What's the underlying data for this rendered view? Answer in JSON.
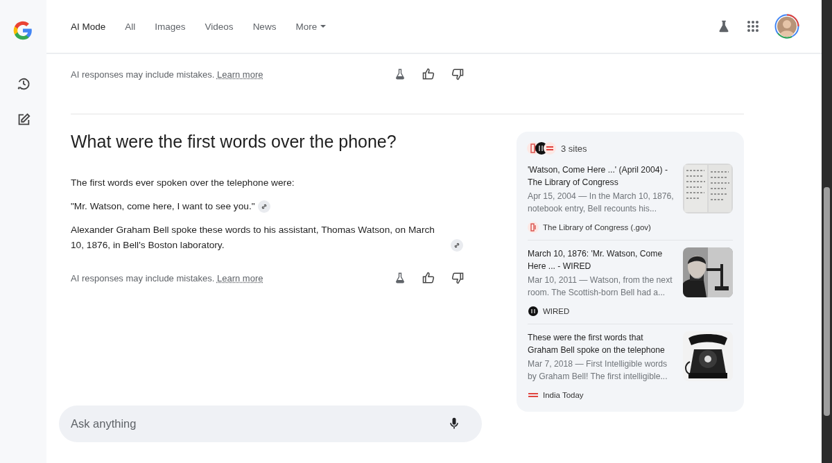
{
  "header": {
    "tabs": [
      {
        "label": "AI Mode",
        "selected": true,
        "kind": "tab"
      },
      {
        "label": "All",
        "selected": false,
        "kind": "tab"
      },
      {
        "label": "Images",
        "selected": false,
        "kind": "tab"
      },
      {
        "label": "Videos",
        "selected": false,
        "kind": "tab"
      },
      {
        "label": "News",
        "selected": false,
        "kind": "tab"
      },
      {
        "label": "More",
        "selected": false,
        "kind": "menu"
      }
    ]
  },
  "previous_answer": {
    "disclaimer": "AI responses may include mistakes.",
    "link": "Learn more"
  },
  "question": "What were the first words over the phone?",
  "answer": {
    "paragraphs": [
      {
        "text": "The first words ever spoken over the telephone were:",
        "cited": false
      },
      {
        "text": "\"Mr. Watson, come here, I want to see you.\"",
        "cited": true
      },
      {
        "text": "Alexander Graham Bell spoke these words to his assistant, Thomas Watson, on March 10, 1876, in Bell's Boston laboratory.",
        "cited": true
      }
    ],
    "disclaimer": "AI responses may include mistakes.",
    "link": "Learn more"
  },
  "sources": {
    "label": "3 sites",
    "items": [
      {
        "title": "'Watson, Come Here ...' (April 2004) - The Library of Congress",
        "snippet": "Apr 15, 2004 — In the March 10, 1876, notebook entry, Bell recounts his...",
        "site": "The Library of Congress (.gov)",
        "kind": "manuscript"
      },
      {
        "title": "March 10, 1876: 'Mr. Watson, Come Here ... - WIRED",
        "snippet": "Mar 10, 2011 — Watson, from the next room. The Scottish-born Bell had a...",
        "site": "WIRED",
        "kind": "portrait"
      },
      {
        "title": "These were the first words that Graham Bell spoke on the telephone",
        "snippet": "Mar 7, 2018 — First Intelligible words by Graham Bell! The first intelligible...",
        "site": "India Today",
        "kind": "telephone"
      }
    ]
  },
  "search": {
    "placeholder": "Ask anything"
  }
}
